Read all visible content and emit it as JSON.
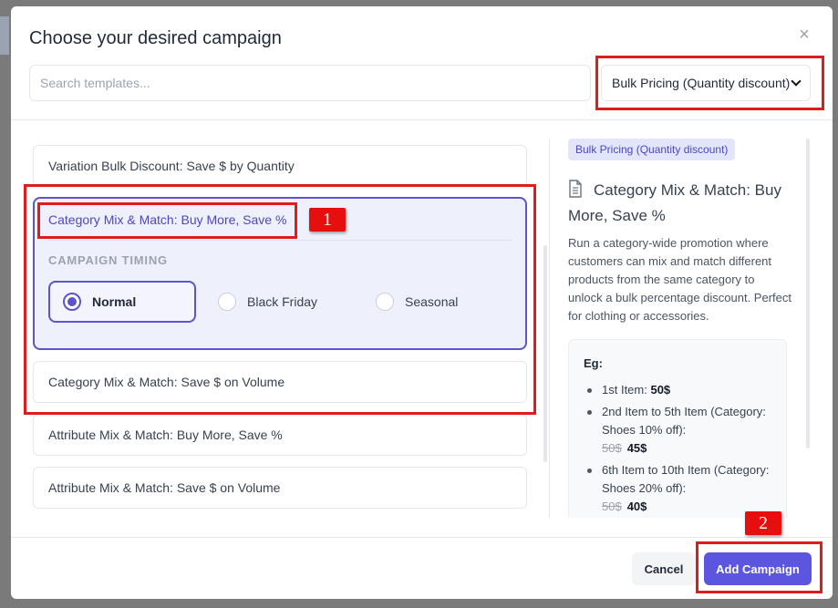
{
  "modal": {
    "title": "Choose your desired campaign",
    "close_glyph": "×"
  },
  "search": {
    "placeholder": "Search templates..."
  },
  "category_select": {
    "value": "Bulk Pricing (Quantity discount)"
  },
  "templates": [
    {
      "label": "Variation Bulk Discount: Save $ by Quantity"
    },
    {
      "label": "Category Mix & Match: Buy More, Save %",
      "selected": true
    },
    {
      "label": "Category Mix & Match: Save $ on Volume"
    },
    {
      "label": "Attribute Mix & Match: Buy More, Save %"
    },
    {
      "label": "Attribute Mix & Match: Save $ on Volume"
    }
  ],
  "timing": {
    "label": "CAMPAIGN TIMING",
    "options": [
      {
        "label": "Normal",
        "checked": true
      },
      {
        "label": "Black Friday",
        "checked": false
      },
      {
        "label": "Seasonal",
        "checked": false
      }
    ]
  },
  "preview": {
    "badge": "Bulk Pricing (Quantity discount)",
    "doc_icon": "document-icon",
    "title": "Category Mix & Match: Buy More, Save %",
    "description": "Run a category-wide promotion where customers can mix and match different products from the same category to unlock a bulk percentage discount. Perfect for clothing or accessories.",
    "example": {
      "label": "Eg:",
      "items": [
        {
          "text": "1st Item: ",
          "price": "50$"
        },
        {
          "text": "2nd Item to 5th Item (Category: Shoes 10% off):",
          "old_price": "50$",
          "price": "45$"
        },
        {
          "text": "6th Item to 10th Item (Category: Shoes 20% off):",
          "old_price": "50$",
          "price": "40$"
        }
      ]
    }
  },
  "footer": {
    "cancel_label": "Cancel",
    "add_label": "Add Campaign"
  },
  "annotations": {
    "step1": "1",
    "step2": "2",
    "highlight_color": "#e11a1a"
  },
  "colors": {
    "accent": "#5b55e0",
    "selected_bg": "#eef0fc"
  }
}
